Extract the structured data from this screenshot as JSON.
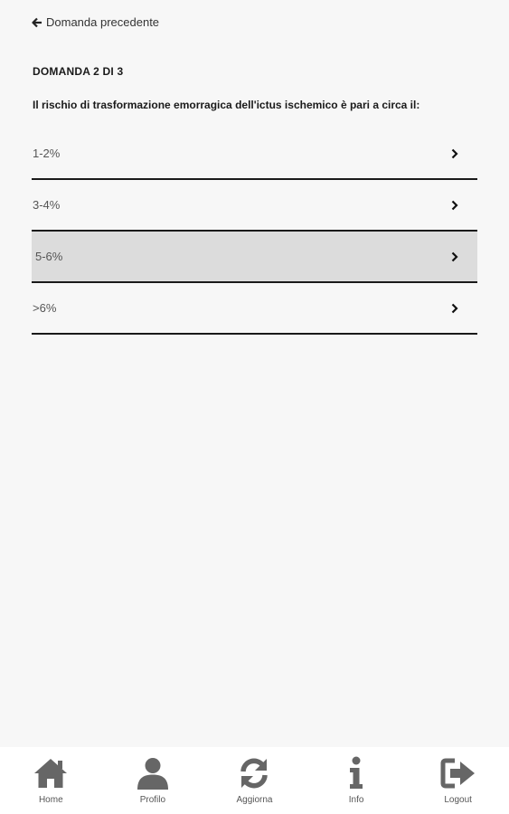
{
  "nav": {
    "back_label": "Domanda precedente"
  },
  "question": {
    "counter": "DOMANDA 2 DI 3",
    "text": "Il rischio di trasformazione emorragica dell'ictus ischemico è pari a circa il:"
  },
  "answers": [
    {
      "label": "1-2%"
    },
    {
      "label": "3-4%"
    },
    {
      "label": "5-6%"
    },
    {
      "label": ">6%"
    }
  ],
  "selected_answer": "5-6%",
  "tabbar": {
    "items": [
      {
        "label": "Home",
        "icon": "home-icon"
      },
      {
        "label": "Profilo",
        "icon": "user-icon"
      },
      {
        "label": "Aggiorna",
        "icon": "refresh-icon"
      },
      {
        "label": "Info",
        "icon": "info-icon"
      },
      {
        "label": "Logout",
        "icon": "logout-icon"
      }
    ]
  },
  "colors": {
    "background": "#f7f7f7",
    "selected_row": "#dcdcdc",
    "icon": "#666666",
    "divider": "#1a1a1a"
  }
}
